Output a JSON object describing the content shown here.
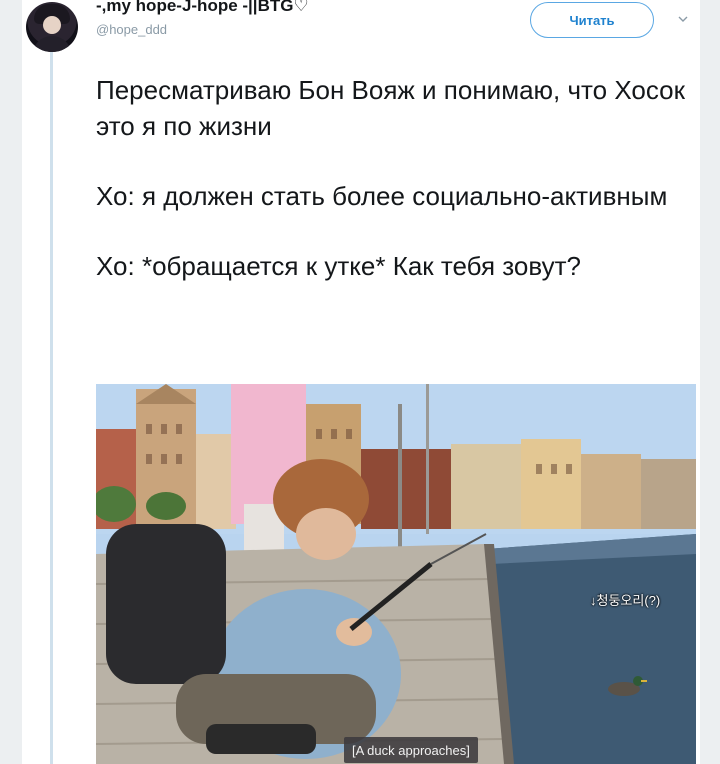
{
  "tweet": {
    "user_name": "-,my hope-J-hope -||BTG♡",
    "user_handle": "@hope_ddd",
    "follow_label": "Читать",
    "paragraphs": [
      "Пересматриваю Бон Вояж и понимаю, что Хосок это я по жизни",
      "Хо: я должен стать более социально-активным",
      "Хо: *обращается к утке* Как тебя зовут?"
    ]
  },
  "media": {
    "korean_label": "↓청둥오리(?)",
    "caption": "[A duck approaches]"
  },
  "icons": {
    "more": "chevron-down-icon",
    "avatar": "avatar"
  },
  "colors": {
    "accent": "#1f82cf",
    "thread_line": "#cfe0ec"
  }
}
